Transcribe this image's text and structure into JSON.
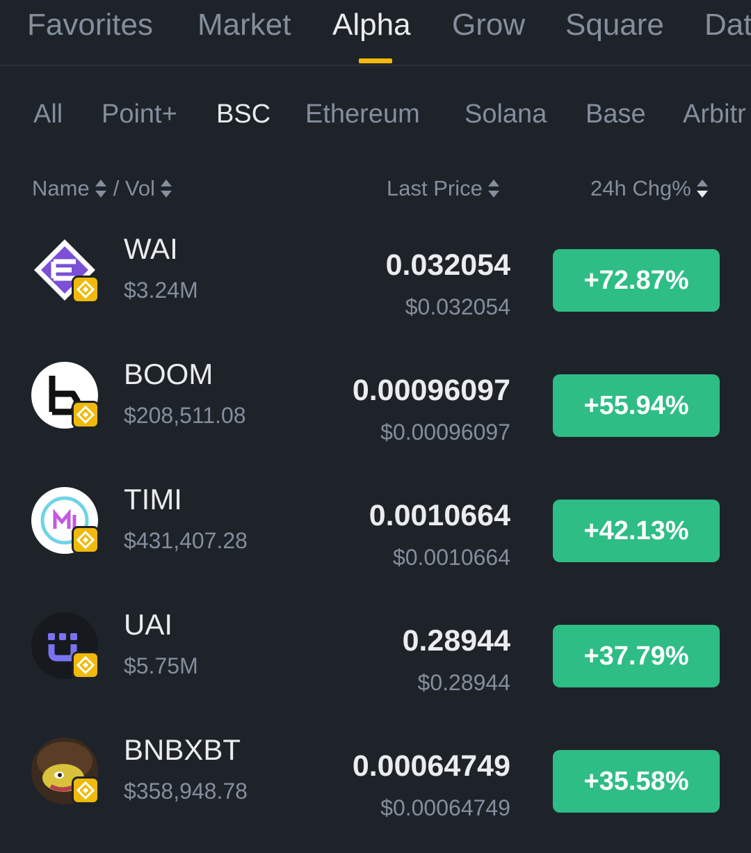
{
  "top_tabs": [
    "Favorites",
    "Market",
    "Alpha",
    "Grow",
    "Square",
    "Dat"
  ],
  "sub_tabs": [
    "All",
    "Point+",
    "BSC",
    "Ethereum",
    "Solana",
    "Base",
    "Arbitr"
  ],
  "columns": {
    "name": "Name",
    "sep": "/ Vol",
    "price": "Last Price",
    "change": "24h Chg%"
  },
  "rows": [
    {
      "symbol": "WAI",
      "volume": "$3.24M",
      "price": "0.032054",
      "usd": "$0.032054",
      "change": "+72.87%"
    },
    {
      "symbol": "BOOM",
      "volume": "$208,511.08",
      "price": "0.00096097",
      "usd": "$0.00096097",
      "change": "+55.94%"
    },
    {
      "symbol": "TIMI",
      "volume": "$431,407.28",
      "price": "0.0010664",
      "usd": "$0.0010664",
      "change": "+42.13%"
    },
    {
      "symbol": "UAI",
      "volume": "$5.75M",
      "price": "0.28944",
      "usd": "$0.28944",
      "change": "+37.79%"
    },
    {
      "symbol": "BNBXBT",
      "volume": "$358,948.78",
      "price": "0.00064749",
      "usd": "$0.00064749",
      "change": "+35.58%"
    }
  ],
  "colors": {
    "background": "#1e2329",
    "accent": "#f0b90b",
    "positive": "#2ebd85",
    "muted": "#848e9c"
  },
  "icons": [
    "wai-logo-icon",
    "boom-logo-icon",
    "timi-logo-icon",
    "uai-logo-icon",
    "bnbxbt-logo-icon",
    "bnb-chain-icon",
    "sort-icon"
  ]
}
